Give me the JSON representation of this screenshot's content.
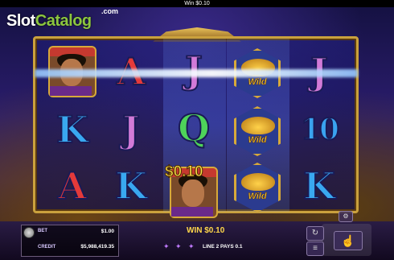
{
  "topbar": {
    "text": "Win $0.10"
  },
  "logo": {
    "part1": "Slot",
    "part2": "Catalog",
    "suffix": ".com"
  },
  "reels": {
    "col1": [
      "hero",
      "K",
      "A"
    ],
    "col2": [
      "A",
      "J",
      "K"
    ],
    "col3": [
      "J",
      "Q",
      "hero"
    ],
    "col4": [
      "wild",
      "wild",
      "wild"
    ],
    "col5": [
      "J",
      "10",
      "K"
    ],
    "wild_label": "Wild",
    "symbol_text": {
      "A": "A",
      "J": "J",
      "K": "K",
      "Q": "Q",
      "10": "10"
    }
  },
  "win_overlay": "$0.10",
  "panel": {
    "bet_label": "BET",
    "bet_value": "$1.00",
    "credit_label": "CREDIT",
    "credit_value": "$5,988,419.35"
  },
  "win_display": {
    "label": "WIN",
    "amount": "$0.10"
  },
  "line_info": "LINE 2 PAYS 0.1",
  "colors": {
    "accent_gold": "#ffd84a",
    "frame": "#caa13d",
    "logo_green": "#8cc63f"
  },
  "icons": [
    "coin-icon",
    "settings-icon",
    "autoplay-icon",
    "spin-icon"
  ]
}
